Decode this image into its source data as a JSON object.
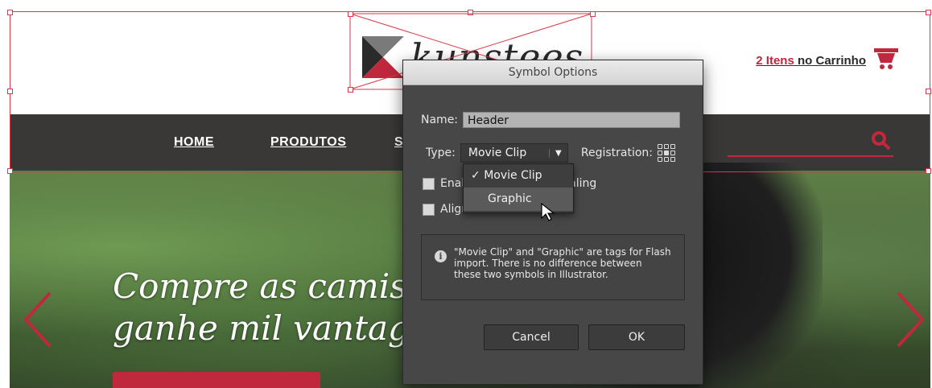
{
  "site": {
    "logo_text": "kunstees",
    "cart": {
      "count": "2 Itens",
      "label": " no Carrinho",
      "icon": "cart-icon"
    },
    "nav": [
      {
        "label": "HOME"
      },
      {
        "label": "PRODUTOS"
      },
      {
        "label": "S"
      }
    ],
    "hero": {
      "line1": "Compre as camiset",
      "line2": "ganhe mil vantage"
    },
    "colors": {
      "accent": "#c0283d",
      "nav_bg": "#3a3737",
      "selection": "#d63a4a"
    }
  },
  "dialog": {
    "title": "Symbol Options",
    "name_label": "Name:",
    "name_value": "Header",
    "type_label": "Type:",
    "type_value": "Movie Clip",
    "registration_label": "Registration:",
    "option1_label_a": "Enal",
    "option1_label_b": "Slice Scaling",
    "option2_label": "Align to Pixel Grid",
    "type_options": [
      {
        "label": "Movie Clip",
        "checked": true
      },
      {
        "label": "Graphic",
        "checked": false
      }
    ],
    "info_text": "\"Movie Clip\" and \"Graphic\" are tags for Flash import. There is no difference between these two symbols in Illustrator.",
    "cancel_label": "Cancel",
    "ok_label": "OK"
  }
}
